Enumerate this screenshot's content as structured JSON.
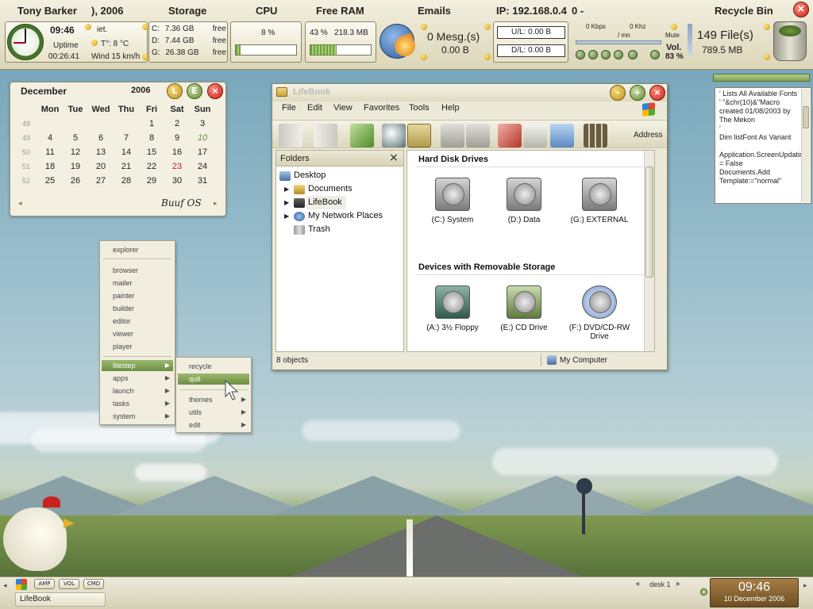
{
  "topbar": {
    "user": "Tony Barker",
    "date_partial": "), 2006",
    "storage_title": "Storage",
    "cpu_title": "CPU",
    "ram_title": "Free RAM",
    "emails_title": "Emails",
    "ip": "IP: 192.168.0.4",
    "ip_suffix": "0 -",
    "recycle_title": "Recycle Bin",
    "clock_time": "09:46",
    "uptime_label": "Uptime",
    "uptime_value": "00:26:41",
    "weather_partial": "iet.",
    "temp": "T°: 8 °C",
    "wind": "Wind 15 km/h",
    "drives": [
      {
        "letter": "C:",
        "size": "7.36 GB",
        "state": "free"
      },
      {
        "letter": "D:",
        "size": "7.44 GB",
        "state": "free"
      },
      {
        "letter": "G:",
        "size": "26.38 GB",
        "state": "free"
      }
    ],
    "cpu_value": "8 %",
    "cpu_fraction": 0.08,
    "ram_percent": "43 %",
    "ram_value": "218.3 MB",
    "ram_fraction": 0.43,
    "mesg_count": "0 Mesg.(s)",
    "mesg_size": "0.00 B",
    "ul": "U/L:  0.00 B",
    "dl": "D/L:  0.00 B",
    "kbps": "0 Kbps",
    "khz": "0 Khz",
    "per_mn": "/ mn",
    "mute": "Mute",
    "vol_label": "Vol.",
    "vol_value": "83 %",
    "files": "149 File(s)",
    "files_size": "789.5 MB"
  },
  "calendar": {
    "month": "December",
    "year": "2006",
    "btn_l": "L",
    "btn_e": "E",
    "close": "×",
    "weekdays": [
      "Mon",
      "Tue",
      "Wed",
      "Thu",
      "Fri",
      "Sat",
      "Sun"
    ],
    "weeks": [
      {
        "wk": "48",
        "days": [
          "",
          "",
          "",
          "",
          "1",
          "2",
          "3"
        ]
      },
      {
        "wk": "49",
        "days": [
          "4",
          "5",
          "6",
          "7",
          "8",
          "9",
          "10"
        ]
      },
      {
        "wk": "50",
        "days": [
          "11",
          "12",
          "13",
          "14",
          "15",
          "16",
          "17"
        ]
      },
      {
        "wk": "51",
        "days": [
          "18",
          "19",
          "20",
          "21",
          "22",
          "23",
          "24"
        ]
      },
      {
        "wk": "52",
        "days": [
          "25",
          "26",
          "27",
          "28",
          "29",
          "30",
          "31"
        ]
      }
    ],
    "signature": "Buuf OS",
    "prev": "◂",
    "next": "▸"
  },
  "launcher": {
    "top_item": "explorer",
    "apps": [
      "browser",
      "mailer",
      "painter",
      "builder",
      "editor",
      "viewer",
      "player"
    ],
    "groups": [
      "litestep",
      "apps",
      "launch",
      "tasks",
      "system"
    ],
    "sub1": [
      "recycle",
      "quit"
    ],
    "sub2": [
      "themes",
      "utils",
      "edit"
    ]
  },
  "explorer": {
    "title": "LifeBook",
    "menus": [
      "File",
      "Edit",
      "View",
      "Favorites",
      "Tools",
      "Help"
    ],
    "address_label": "Address",
    "folders_title": "Folders",
    "folders_close": "×",
    "tree": [
      "Desktop",
      "Documents",
      "LifeBook",
      "My Network Places",
      "Trash"
    ],
    "sec_hdd": "Hard Disk Drives",
    "hdds": [
      "(C:) System",
      "(D:) Data",
      "(G:) EXTERNAL"
    ],
    "sec_rem": "Devices with Removable Storage",
    "removables": [
      "(A:) 3½ Floppy",
      "(E:) CD Drive",
      "(F:) DVD/CD-RW Drive"
    ],
    "status_left": "8 objects",
    "status_right": "My Computer"
  },
  "codebox": {
    "lines": [
      "' Lists All Available Fonts",
      "' \"&chr(10)&\"Macro",
      "created 01/08/2003 by",
      "The Mekon",
      "'",
      "Dim listFont As Variant",
      "",
      "Application.ScreenUpdating = False",
      "    Documents.Add",
      "Template:=\"normal\""
    ]
  },
  "taskbar": {
    "btns": [
      "AMP",
      "VOL",
      "CMD"
    ],
    "task": "LifeBook",
    "desk": "desk 1",
    "time": "09:46",
    "date": "10 December 2006"
  }
}
